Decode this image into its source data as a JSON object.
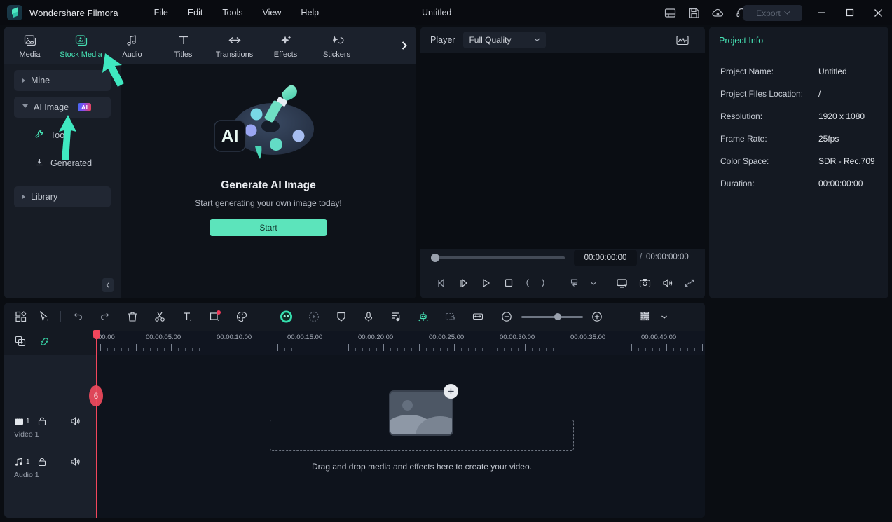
{
  "titlebar": {
    "app_name": "Wondershare Filmora",
    "menus": [
      "File",
      "Edit",
      "Tools",
      "View",
      "Help"
    ],
    "doc_title": "Untitled",
    "icons": [
      "layout-icon",
      "save-icon",
      "cloud-upload-icon",
      "headset-support-icon",
      "apps-grid-icon"
    ],
    "avatar": "user-avatar",
    "export_label": "Export",
    "window_controls": [
      "minimize",
      "maximize",
      "close"
    ]
  },
  "media_panel": {
    "tabs": [
      {
        "label": "Media",
        "icon": "media-icon",
        "active": false
      },
      {
        "label": "Stock Media",
        "icon": "stock-media-icon",
        "active": true
      },
      {
        "label": "Audio",
        "icon": "audio-note-icon",
        "active": false
      },
      {
        "label": "Titles",
        "icon": "titles-text-icon",
        "active": false
      },
      {
        "label": "Transitions",
        "icon": "transitions-arrows-icon",
        "active": false
      },
      {
        "label": "Effects",
        "icon": "effects-sparkle-icon",
        "active": false
      },
      {
        "label": "Stickers",
        "icon": "stickers-icon",
        "active": false
      }
    ],
    "more_tabs_icon": "chevron-right-icon",
    "sidebar": [
      {
        "label": "Mine",
        "type": "group",
        "expanded": false,
        "badge": null
      },
      {
        "label": "AI Image",
        "type": "group",
        "expanded": true,
        "badge": "AI"
      },
      {
        "label": "Tool",
        "type": "child",
        "icon": "wrench-icon"
      },
      {
        "label": "Generated",
        "type": "child",
        "icon": "download-icon"
      },
      {
        "label": "Library",
        "type": "group",
        "expanded": false,
        "badge": null
      }
    ],
    "collapse_icon": "chevron-left-icon",
    "content": {
      "illustration": "ai-palette-illustration",
      "badge_text": "AI",
      "title": "Generate AI Image",
      "subtitle": "Start generating your own image today!",
      "button_label": "Start"
    }
  },
  "player": {
    "label": "Player",
    "quality": "Full Quality",
    "quality_chevron": "chevron-down-icon",
    "scope_icon": "waveform-scope-icon",
    "current_time": "00:00:00:00",
    "separator": "/",
    "total_time": "00:00:00:00",
    "controls": [
      "prev-frame-icon",
      "next-frame-icon",
      "play-icon",
      "stop-icon",
      "mark-in-icon",
      "mark-out-icon",
      "record-dropdown-icon",
      "chevron-down-icon",
      "screen-cast-icon",
      "snapshot-icon",
      "volume-icon",
      "fullscreen-icon"
    ]
  },
  "project_info": {
    "tab_label": "Project Info",
    "rows": [
      {
        "key": "Project Name:",
        "value": "Untitled"
      },
      {
        "key": "Project Files Location:",
        "value": "/"
      },
      {
        "key": "Resolution:",
        "value": "1920 x 1080"
      },
      {
        "key": "Frame Rate:",
        "value": "25fps"
      },
      {
        "key": "Color Space:",
        "value": "SDR - Rec.709"
      },
      {
        "key": "Duration:",
        "value": "00:00:00:00"
      }
    ]
  },
  "timeline": {
    "toolbar_left": [
      "template-grid-icon",
      "select-tool-icon"
    ],
    "toolbar_mid": [
      "undo-icon",
      "redo-icon",
      "delete-icon",
      "split-scissors-icon",
      "text-tool-icon",
      "crop-tool-icon",
      "color-palette-icon"
    ],
    "toolbar_ai": [
      "ai-face-icon",
      "motion-tracking-icon",
      "mask-icon",
      "voice-record-icon",
      "audio-beat-icon",
      "green-screen-icon",
      "keyframe-icon",
      "fit-timeline-icon"
    ],
    "zoom_out_icon": "zoom-out-icon",
    "zoom_in_icon": "zoom-in-icon",
    "render_icon": "render-bar-icon",
    "render_chevron": "chevron-down-icon",
    "track_toolbar": [
      "add-track-icon",
      "link-chain-icon"
    ],
    "ruler_marks": [
      "00:00",
      "00:00:05:00",
      "00:00:10:00",
      "00:00:15:00",
      "00:00:20:00",
      "00:00:25:00",
      "00:00:30:00",
      "00:00:35:00",
      "00:00:40:00"
    ],
    "tracks": [
      {
        "name": "Video 1",
        "num": "1",
        "type": "video",
        "icons": [
          "video-track-icon",
          "lock-icon",
          "mute-icon",
          "eye-icon"
        ]
      },
      {
        "name": "Audio 1",
        "num": "1",
        "type": "audio",
        "icons": [
          "audio-track-icon",
          "lock-icon",
          "mute-icon"
        ]
      }
    ],
    "dropzone_text": "Drag and drop media and effects here to create your video.",
    "dropzone_card": "media-thumbnail-placeholder",
    "add_media_icon": "plus-circle-icon"
  },
  "colors": {
    "accent": "#46e3b5",
    "start_button": "#5ce4bb",
    "playhead": "#f2465c",
    "panel_bg": "#141922",
    "window_bg": "#090b10"
  }
}
